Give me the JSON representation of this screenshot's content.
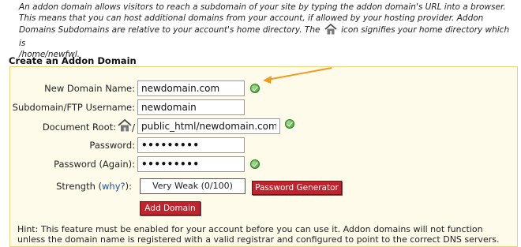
{
  "intro": {
    "text": "An addon domain allows visitors to reach a subdomain of your site by typing the addon domain's URL into a browser. This means that you can host additional domains from your account, if allowed by your hosting provider. Addon Domains Subdomains are relative to your account's home directory. The",
    "text_after_icon": "icon signifies your home directory which is",
    "home_path": "/home/newfwl."
  },
  "section_title": "Create an Addon Domain",
  "form": {
    "new_domain_label": "New Domain Name:",
    "new_domain_value": "newdomain.com",
    "subdomain_label": "Subdomain/FTP Username:",
    "subdomain_value": "newdomain",
    "docroot_label": "Document Root:",
    "docroot_prefix": "/",
    "docroot_value": "public_html/newdomain.com",
    "password_label": "Password:",
    "password_value": "•••••••••",
    "password_again_label": "Password (Again):",
    "password_again_value": "•••••••••",
    "strength_label": "Strength (",
    "strength_why": "why?",
    "strength_close": "):",
    "strength_value": "Very Weak (0/100)",
    "password_generator_label": "Password Generator",
    "add_domain_label": "Add Domain"
  },
  "hint": "Hint: This feature must be enabled for your account before you can use it. Addon domains will not function unless the domain name is registered with a valid registrar and configured to point to the correct DNS servers.",
  "colors": {
    "panel_bg": "#fffbea",
    "panel_border": "#e6d47e",
    "button_red": "#c0232b",
    "check_green": "#3e9c2e",
    "arrow_orange": "#f39a1e",
    "link_blue": "#1c4fa0"
  },
  "icons": [
    "home-icon",
    "check-icon",
    "annotation-arrow"
  ]
}
